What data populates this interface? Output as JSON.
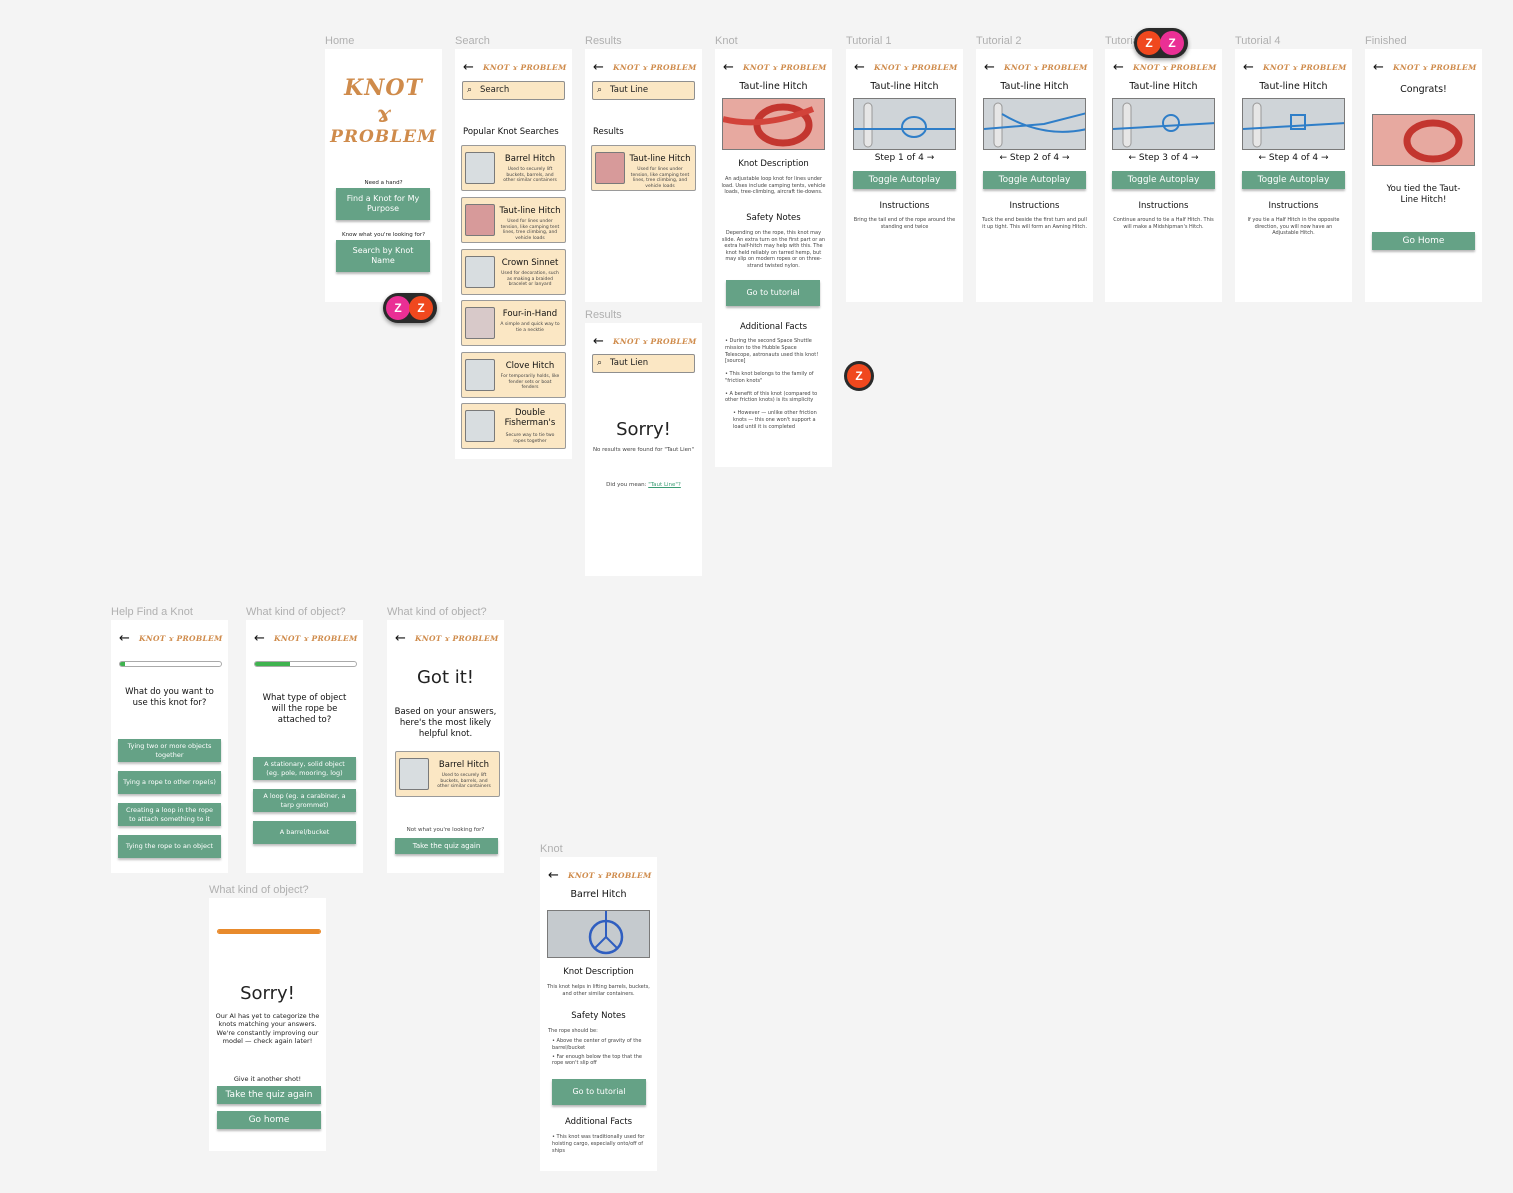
{
  "logo": {
    "line1": "KNOT",
    "line2": "PROBLEM"
  },
  "frames": {
    "home": {
      "label": "Home",
      "need": "Need a hand?",
      "find": "Find a Knot for My Purpose",
      "know": "Know what you're looking for?",
      "search": "Search by Knot Name"
    },
    "search": {
      "label": "Search",
      "search_placeholder": "Search",
      "popular": "Popular Knot Searches",
      "cards": [
        {
          "title": "Barrel Hitch",
          "desc": "Used to securely lift buckets, barrels, and other similar containers"
        },
        {
          "title": "Taut-line Hitch",
          "desc": "Used for lines under tension, like camping tent lines, tree climbing, and vehicle loads"
        },
        {
          "title": "Crown Sinnet",
          "desc": "Used for decoration, such as making a braided bracelet or lanyard"
        },
        {
          "title": "Four-in-Hand",
          "desc": "A simple and quick way to tie a necktie"
        },
        {
          "title": "Clove Hitch",
          "desc": "For temporarily holds, like fender sets or boat fenders"
        },
        {
          "title": "Double Fisherman's",
          "desc": "Secure way to tie two ropes together"
        }
      ]
    },
    "results": {
      "label": "Results",
      "query": "Taut Line",
      "heading": "Results",
      "card_title": "Taut-line Hitch",
      "card_desc": "Used for lines under tension, like camping tent lines, tree climbing, and vehicle loads"
    },
    "results2": {
      "label": "Results",
      "query": "Taut Lien",
      "sorry": "Sorry!",
      "none": "No results were found for \"Taut Lien\"",
      "didyou": "Did you mean: ",
      "suggest": "\"Taut Line\"?"
    },
    "knot": {
      "label": "Knot",
      "title": "Taut-line Hitch",
      "desc_h": "Knot Description",
      "desc": "An adjustable loop knot for lines under load. Uses include camping tents, vehicle loads, tree-climbing, aircraft tie-downs.",
      "safety_h": "Safety Notes",
      "safety": "Depending on the rope, this knot may slide. An extra turn on the first part or an extra half-hitch may help with this. The knot held reliably on tarred hemp, but may slip on modern ropes or on three-strand twisted nylon.",
      "tutorial": "Go to tutorial",
      "facts_h": "Additional Facts",
      "facts": [
        "During the second Space Shuttle mission to the Hubble Space Telescope, astronauts used this knot! [source]",
        "This knot belongs to the family of \"friction knots\"",
        "A benefit of this knot (compared to other friction knots) is its simplicity",
        "However — unlike other friction knots — this one won't support a load until it is completed"
      ]
    },
    "tut1": {
      "label": "Tutorial 1",
      "title": "Taut-line Hitch",
      "step": "Step 1 of 4",
      "toggle": "Toggle Autoplay",
      "instr_h": "Instructions",
      "instr": "Bring the tail end of the rope around the standing end twice"
    },
    "tut2": {
      "label": "Tutorial 2",
      "title": "Taut-line Hitch",
      "step": "Step 2 of 4",
      "toggle": "Toggle Autoplay",
      "instr_h": "Instructions",
      "instr": "Tuck the end beside the first turn and pull it up tight. This will form an Awning Hitch."
    },
    "tut3": {
      "label": "Tutorial 3",
      "title": "Taut-line Hitch",
      "step": "Step 3 of 4",
      "toggle": "Toggle Autoplay",
      "instr_h": "Instructions",
      "instr": "Continue around to tie a Half Hitch. This will make a Midshipman's Hitch."
    },
    "tut4": {
      "label": "Tutorial 4",
      "title": "Taut-line Hitch",
      "step": "Step 4 of 4",
      "toggle": "Toggle Autoplay",
      "instr_h": "Instructions",
      "instr": "If you tie a Half Hitch in the opposite direction, you will now have an Adjustable Hitch."
    },
    "finished": {
      "label": "Finished",
      "congrats": "Congrats!",
      "msg": "You tied the Taut-Line Hitch!",
      "home": "Go Home"
    },
    "help": {
      "label": "Help Find a Knot",
      "progress": 0.05,
      "question": "What do you want to use this knot for?",
      "options": [
        "Tying two or more objects together",
        "Tying a rope to other rope(s)",
        "Creating a loop in the rope to attach something to it",
        "Tying the rope to an object"
      ]
    },
    "kind1": {
      "label": "What kind of object?",
      "progress": 0.35,
      "question": "What type of object will the rope be attached to?",
      "options": [
        "A stationary, solid object (eg. pole, mooring, log)",
        "A loop (eg. a carabiner, a tarp grommet)",
        "A barrel/bucket"
      ]
    },
    "kind2": {
      "label": "What kind of object?",
      "got": "Got it!",
      "based": "Based on your answers, here's the most likely helpful knot.",
      "card_title": "Barrel Hitch",
      "card_desc": "Used to securely lift buckets, barrels, and other similar containers",
      "notwhat": "Not what you're looking for?",
      "again": "Take the quiz again"
    },
    "kind3": {
      "label": "What kind of object?",
      "progress": 1.0,
      "sorry": "Sorry!",
      "msg": "Our AI has yet to categorize the knots matching your answers. We're constantly improving our model — check again later!",
      "give": "Give it another shot!",
      "again": "Take the quiz again",
      "home": "Go home"
    },
    "knot2": {
      "label": "Knot",
      "title": "Barrel Hitch",
      "desc_h": "Knot Description",
      "desc": "This knot helps in lifting barrels, buckets, and other similar containers.",
      "safety_h": "Safety Notes",
      "safety_intro": "The rope should be:",
      "safety": [
        "Above the center of gravity of the barrel/bucket",
        "Far enough below the top that the rope won't slip off"
      ],
      "tutorial": "Go to tutorial",
      "facts_h": "Additional Facts",
      "facts": [
        "This knot was traditionally used for hoisting cargo, especially onto/off of ships"
      ]
    }
  },
  "avatars": {
    "z": "Z"
  },
  "colors": {
    "accent": "#65a286",
    "logo": "#cf8b4b",
    "card": "#fbe7c4",
    "progress": "#3fb34f",
    "progress_full": "#e88a2c"
  }
}
